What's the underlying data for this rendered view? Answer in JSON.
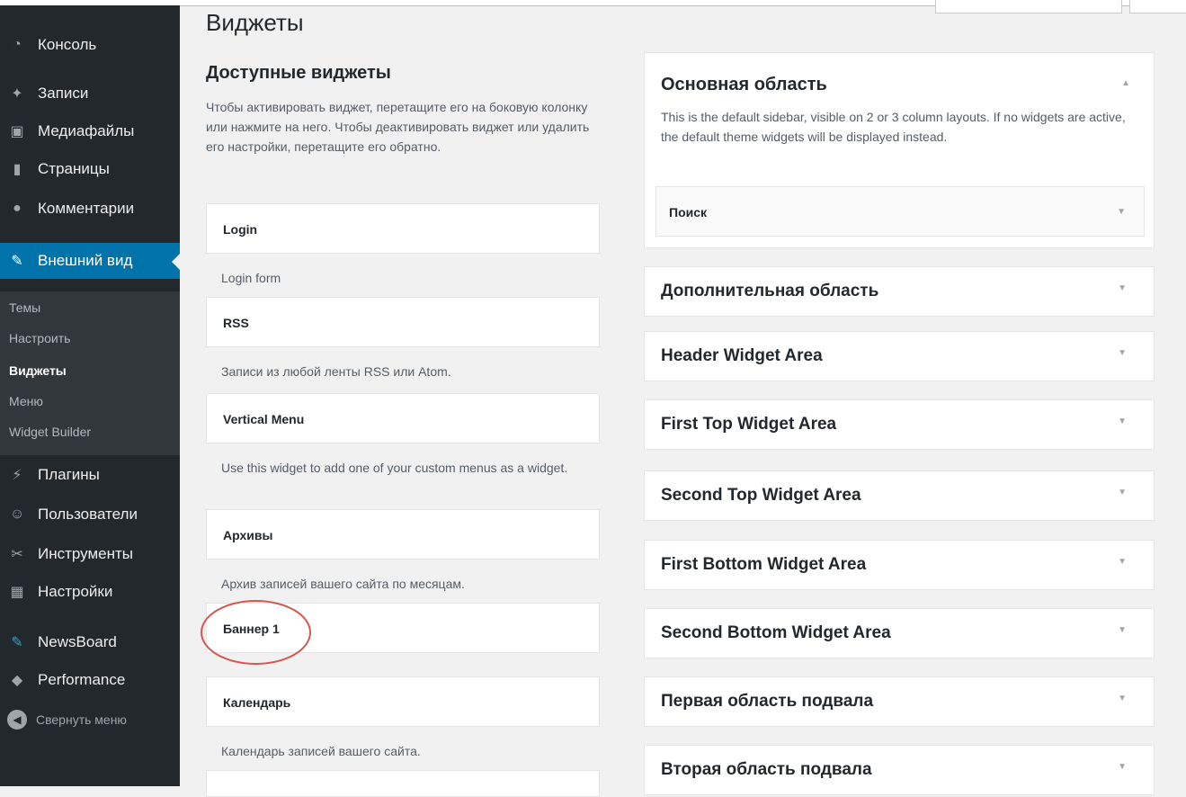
{
  "sidebar": {
    "items": [
      {
        "icon": "dashboard-icon",
        "glyph": "◔",
        "label": "Консоль"
      },
      {
        "icon": "pin-icon",
        "glyph": "✦",
        "label": "Записи"
      },
      {
        "icon": "media-icon",
        "glyph": "▣",
        "label": "Медиафайлы"
      },
      {
        "icon": "page-icon",
        "glyph": "▮",
        "label": "Страницы"
      },
      {
        "icon": "comment-icon",
        "glyph": "●",
        "label": "Комментарии"
      },
      {
        "icon": "brush-icon",
        "glyph": "✎",
        "label": "Внешний вид"
      },
      {
        "icon": "plugin-icon",
        "glyph": "⚡",
        "label": "Плагины"
      },
      {
        "icon": "users-icon",
        "glyph": "☺",
        "label": "Пользователи"
      },
      {
        "icon": "tools-icon",
        "glyph": "✂",
        "label": "Инструменты"
      },
      {
        "icon": "settings-icon",
        "glyph": "▦",
        "label": "Настройки"
      },
      {
        "icon": "newsboard-icon",
        "glyph": "✎",
        "label": "NewsBoard"
      },
      {
        "icon": "performance-icon",
        "glyph": "◆",
        "label": "Performance"
      }
    ],
    "submenu": [
      "Темы",
      "Настроить",
      "Виджеты",
      "Меню",
      "Widget Builder"
    ],
    "collapse_label": "Свернуть меню",
    "collapse_glyph": "◀"
  },
  "page": {
    "title": "Виджеты",
    "available_title": "Доступные виджеты",
    "available_desc": "Чтобы активировать виджет, перетащите его на боковую колонку или нажмите на него. Чтобы деактивировать виджет или удалить его настройки, перетащите его обратно."
  },
  "widgets": [
    {
      "title": "Login",
      "desc": "Login form"
    },
    {
      "title": "RSS",
      "desc": "Записи из любой ленты RSS или Atom."
    },
    {
      "title": "Vertical Menu",
      "desc": "Use this widget to add one of your custom menus as a widget."
    },
    {
      "title": "Архивы",
      "desc": "Архив записей вашего сайта по месяцам."
    },
    {
      "title": "Баннер 1",
      "desc": ""
    },
    {
      "title": "Календарь",
      "desc": "Календарь записей вашего сайта."
    }
  ],
  "sidebars": {
    "main": {
      "title": "Основная область",
      "desc": "This is the default sidebar, visible on 2 or 3 column layouts. If no widgets are active, the default theme widgets will be displayed instead.",
      "widgets": [
        "Поиск"
      ]
    },
    "areas": [
      "Дополнительная область",
      "Header Widget Area",
      "First Top Widget Area",
      "Second Top Widget Area",
      "First Bottom Widget Area",
      "Second Bottom Widget Area",
      "Первая область подвала",
      "Вторая область подвала"
    ]
  },
  "colors": {
    "accent": "#0073aa",
    "sidebar_bg": "#23282d",
    "highlight": "#d9534f"
  }
}
